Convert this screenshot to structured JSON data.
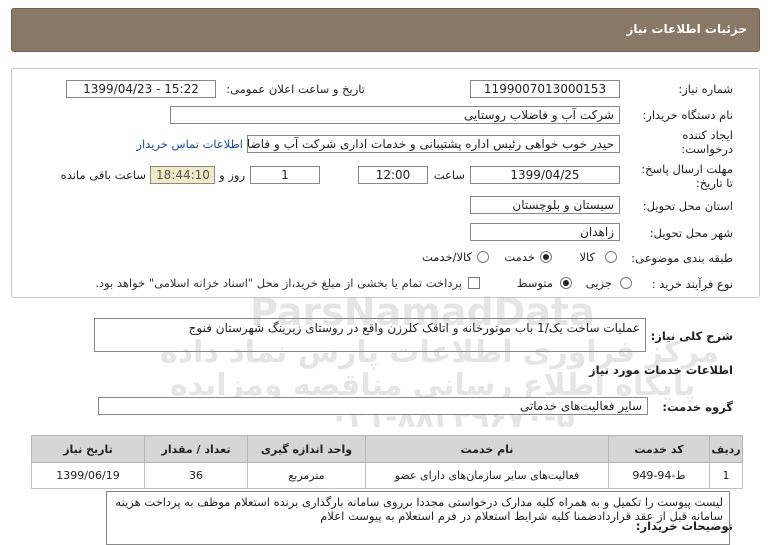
{
  "header": {
    "title": "جزئیات اطلاعات نیاز"
  },
  "form": {
    "need_number_label": "شماره نیاز:",
    "need_number": "1199007013000153",
    "announce_label": "تاریخ و ساعت اعلان عمومی:",
    "announce_value": "1399/04/23 - 15:22",
    "buyer_org_label": "نام دستگاه خریدار:",
    "buyer_org": "شرکت آب و فاضلاب روستایی",
    "creator_label_1": "ایجاد کننده",
    "creator_label_2": "درخواست:",
    "creator_value": "حیدر خوب خواهی  رئیس اداره پشتیبانی و خدمات اداری  شرکت آب و فاضلاب ر",
    "contact_link": "اطلاعات تماس خریدار",
    "deadline_label_1": "مهلت ارسال پاسخ:",
    "deadline_label_2": "تا تاریخ:",
    "deadline_date": "1399/04/25",
    "time_label": "ساعت",
    "deadline_time": "12:00",
    "days_value": "1",
    "days_label": "روز و",
    "remaining_time": "18:44:10",
    "remaining_label": "ساعت باقی مانده",
    "province_label": "استان محل تحویل:",
    "province": "سیستان و بلوچستان",
    "city_label": "شهر محل تحویل:",
    "city": "زاهدان",
    "category_label": "طبقه بندی موضوعی:",
    "category_options": [
      "کالا",
      "خدمت",
      "کالا/خدمت"
    ],
    "category_selected": "خدمت",
    "process_label": "نوع فرآیند خرید :",
    "process_options": [
      "جزیی",
      "متوسط"
    ],
    "process_selected": "متوسط",
    "payment_note": "پرداخت تمام یا بخشی از مبلغ خرید،از محل \"اسناد خزانه اسلامی\" خواهد بود."
  },
  "summary": {
    "label": "شرح کلی نیاز:",
    "value": "عملیات ساخت یک/1 باب موتورخانه و اتاقک کلرزن واقع در روستای زیرینگ شهرستان فنوج"
  },
  "services": {
    "section_title": "اطلاعات خدمات مورد نیاز",
    "group_label": "گروه خدمت:",
    "group_value": "سایر فعالیت‌های خدماتی",
    "columns": [
      "ردیف",
      "کد خدمت",
      "نام خدمت",
      "واحد اندازه گیری",
      "تعداد / مقدار",
      "تاریخ نیاز"
    ],
    "rows": [
      [
        "1",
        "ط-94-949",
        "فعالیت‌های سایر سازمان‌های دارای عضو",
        "مترمربع",
        "36",
        "1399/06/19"
      ]
    ]
  },
  "notes": {
    "label": "توضیحات خریدار:",
    "value": "لیست پیوست را تکمیل و به همراه کلیه مدارک درخواستی مجددا برروی سامانه بارگذاری برنده استعلام موظف به پرداخت هزینه سامانه قبل از عقد قراردادضمنا کلیه شرایط استعلام در فرم استعلام به پیوست اعلام"
  },
  "watermark": {
    "line1": "ParsNamadData",
    "line2": "مرکز فراوری اطلاعات پارس نماد داده",
    "line3": "پایگاه اطلاع رسانی مناقصه ومزایده",
    "line4": "۰۲۱-۸۸۳۴۹۶۷۰-۵"
  }
}
